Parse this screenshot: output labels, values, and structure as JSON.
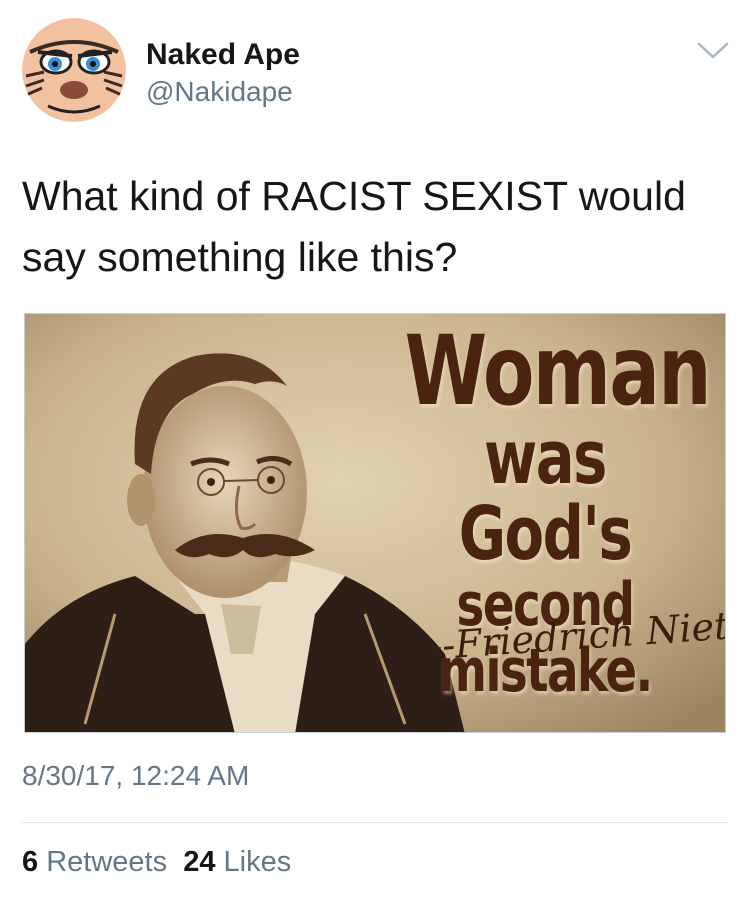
{
  "user": {
    "display_name": "Naked Ape",
    "handle": "@Nakidape"
  },
  "tweet": {
    "text": "What kind of RACIST SEXIST would say something like this?",
    "timestamp": "8/30/17, 12:24 AM"
  },
  "media": {
    "quote_line1": "Woman",
    "quote_line2": "was God's",
    "quote_line3": "second mistake.",
    "signature": "--Friedrich Nietzsche"
  },
  "stats": {
    "retweets_count": "6",
    "retweets_label": "Retweets",
    "likes_count": "24",
    "likes_label": "Likes"
  },
  "icons": {
    "menu": "chevron-down-icon"
  },
  "colors": {
    "text_primary": "#14171a",
    "text_secondary": "#657786",
    "divider": "#e1e8ed",
    "sepia_dark": "#4a2410"
  }
}
